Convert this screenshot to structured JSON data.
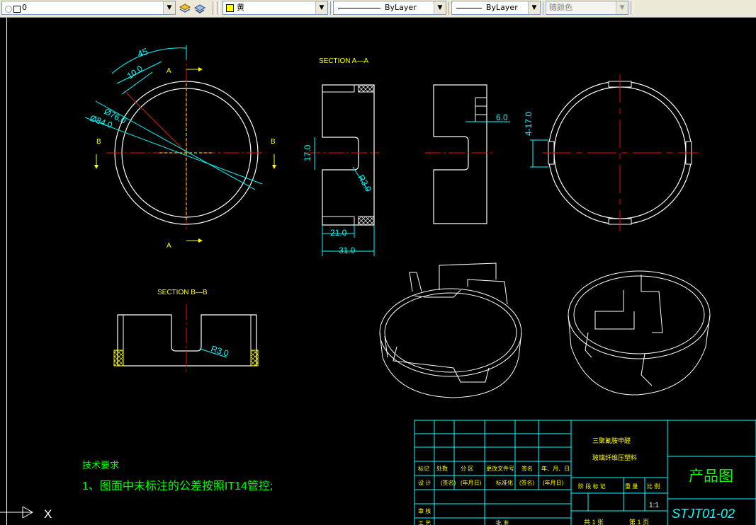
{
  "toolbar": {
    "layer_name": "0",
    "color_value": "黄",
    "color_swatch": "#ffff00",
    "linetype_value": "ByLayer",
    "lineweight_value": "ByLayer",
    "plotstyle_value": "随颜色"
  },
  "drawing": {
    "label_A": "A",
    "label_B": "B",
    "dim_angle": "45",
    "dim_width": "10.0",
    "dim_inner_dia": "Ø76.0",
    "dim_outer_dia": "Ø84.0",
    "section_aa_title": "SECTION  A—A",
    "section_bb_title": "SECTION  B—B",
    "dim_height": "17.0",
    "dim_radius": "R3.0",
    "dim_inner_depth": "21.0",
    "dim_total_depth": "31.0",
    "dim_slot_width": "6.0",
    "dim_slot_count": "4-17.0",
    "tech_heading": "技术要求",
    "tech_note": "1、图面中未标注的公差按照IT14管控;"
  },
  "titleblock": {
    "company_line1": "三聚氰胺甲醛",
    "company_line2": "玻璃纤维压塑料",
    "drawing_title": "产品图",
    "drawing_number": "STJT01-02",
    "scale": "1:1",
    "headers": [
      "标记",
      "处数",
      "分 区",
      "更改文件号",
      "签名",
      "年、月、日"
    ],
    "row_design": [
      "设 计",
      "(签名)",
      "(年月日)",
      "标准化",
      "(签名)",
      "(年月日)"
    ],
    "row_review": "审 核",
    "row_process": "工 艺",
    "approve": "批 准",
    "stage_labels": [
      "阶 段 标 记",
      "重 量",
      "比 例"
    ],
    "sheet_total": "共  1  张",
    "sheet_no": "第  1  页"
  },
  "ucs": {
    "x_label": "X"
  },
  "colors": {
    "background": "#000000",
    "outline": "#ffffff",
    "centerline": "#ff0000",
    "dimension": "#00ffff",
    "annotation": "#ffff00",
    "notes": "#00ff00"
  }
}
